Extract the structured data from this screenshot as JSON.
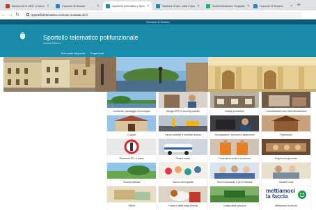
{
  "browser": {
    "tabs": [
      {
        "title": "Benvenuti in URC | Comune di",
        "color": "#c0392b",
        "active": false
      },
      {
        "title": "Comune di Sussex",
        "color": "#2e86c1",
        "active": false
      },
      {
        "title": "Sportello telematico | Sportello",
        "color": "#1a8ba9",
        "active": true
      },
      {
        "title": "Sistema di acc. ridte | Sportello",
        "color": "#1a8ba9",
        "active": false
      },
      {
        "title": "Amministrazione Trasparente",
        "color": "#27ae60",
        "active": false
      },
      {
        "title": "Comune di Sussex",
        "color": "#2e86c1",
        "active": false
      }
    ],
    "new_tab": "+",
    "url": "sportellotelematico.comune.sussaia.mi.it"
  },
  "site": {
    "topbar_title": "Comune di Sussex",
    "title": "Sportello telematico polifunzionale",
    "subtitle": "Comune di Sussex",
    "nav": [
      "Domande frequenti",
      "Pagamenti"
    ]
  },
  "categories": [
    {
      "label": "Ambiente, paesaggio ed ecologia"
    },
    {
      "label": "Alloggi ERP e housing sociale"
    },
    {
      "label": "Attività produttive"
    },
    {
      "label": "Comunicazioni con l'Amministrazione"
    },
    {
      "label": "Cultura"
    },
    {
      "label": "Lavori pubblici e mobilità urbana"
    },
    {
      "label": "Occupazione, concorsi e assunzioni"
    },
    {
      "label": "Patrimonio"
    },
    {
      "label": "Permessi ZTL e sosta"
    },
    {
      "label": "Polizia locale"
    },
    {
      "label": "Protezione civile e sicurezza"
    },
    {
      "label": "Ragioneria generale"
    },
    {
      "label": "Scuola infanzia"
    },
    {
      "label": "Servizi demografici"
    },
    {
      "label": "Servizi scolastici e per l'infanzia"
    },
    {
      "label": "Sociale locali"
    },
    {
      "label": "Tributi"
    },
    {
      "label": "Tutela e diritti degli animali"
    },
    {
      "label": "Tutela della persona"
    },
    {
      "label": "Mettiamoci la faccia"
    }
  ],
  "faccia_banner": {
    "line1": "mettiamoci",
    "line2": "la faccia"
  }
}
